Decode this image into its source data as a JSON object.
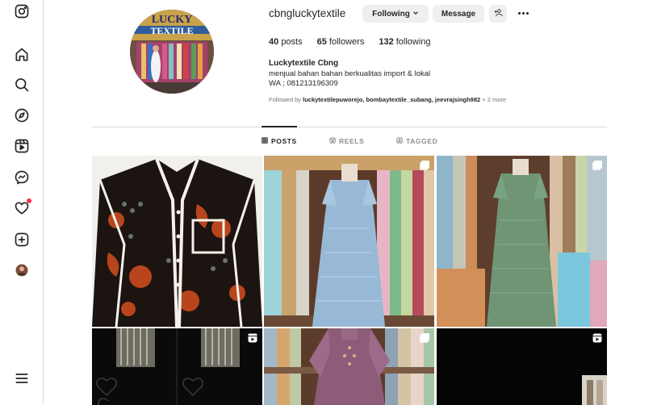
{
  "profile": {
    "username": "cbngluckytextile",
    "following_label": "Following",
    "message_label": "Message",
    "stats": {
      "posts": "40",
      "posts_label": "posts",
      "followers": "65",
      "followers_label": "followers",
      "following": "132",
      "following_label": "following"
    },
    "full_name": "Luckytextile Cbng",
    "bio_line1": "menjual bahan bahan berkualitas import & lokal",
    "bio_line2": "WA ; 081213196309",
    "followed_by_prefix": "Followed by",
    "followed_by_names": "luckytextilepuworejo, bombaytextile_subang, jeevrajsingh982",
    "followed_by_more": "+ 2 more",
    "avatar_sign_text": "LUCKY TEXTILE"
  },
  "tabs": [
    {
      "label": "POSTS",
      "active": true,
      "icon": "grid-icon"
    },
    {
      "label": "REELS",
      "active": false,
      "icon": "reels-icon"
    },
    {
      "label": "TAGGED",
      "active": false,
      "icon": "tagged-icon"
    }
  ],
  "sidebar": {
    "icons": [
      "instagram-logo-icon",
      "home-icon",
      "search-icon",
      "explore-icon",
      "reels-icon",
      "messenger-icon",
      "notifications-heart-icon",
      "create-plus-icon",
      "profile-avatar",
      "menu-icon"
    ]
  },
  "colors": {
    "accent_blue": "#0095f6",
    "notification_red": "#ff3040",
    "button_bg": "#efefef",
    "text_primary": "#262626",
    "text_secondary": "#737373"
  },
  "posts": [
    {
      "subject": "batik shirt",
      "badge": "none"
    },
    {
      "subject": "light blue lace dress",
      "badge": "multi-photo-icon"
    },
    {
      "subject": "green lace dress",
      "badge": "multi-photo-icon"
    },
    {
      "subject": "dark reel",
      "badge": "reel-icon"
    },
    {
      "subject": "mauve lace dress",
      "badge": "multi-photo-icon"
    },
    {
      "subject": "black reel",
      "badge": "reel-icon"
    }
  ]
}
